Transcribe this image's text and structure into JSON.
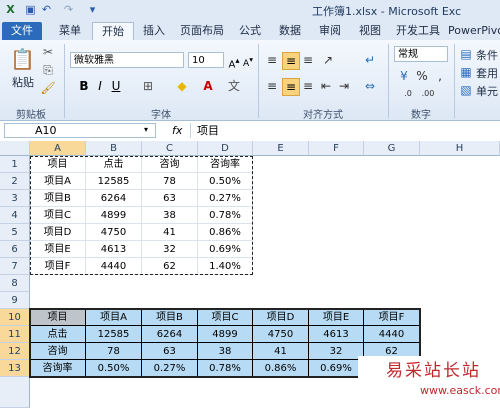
{
  "window": {
    "title": "工作簿1.xlsx - Microsoft Exc"
  },
  "tabs": [
    "文件",
    "菜单",
    "开始",
    "插入",
    "页面布局",
    "公式",
    "数据",
    "审阅",
    "视图",
    "开发工具",
    "PowerPivo"
  ],
  "ribbon": {
    "paste_label": "粘贴",
    "font_name": "微软雅黑",
    "font_size": "10",
    "bold": "B",
    "italic": "I",
    "underline": "U",
    "number_format": "常规",
    "styles_cond": "条件",
    "styles_table": "套用",
    "styles_cell": "单元",
    "groups": [
      "剪贴板",
      "字体",
      "对齐方式",
      "数字"
    ]
  },
  "formula_bar": {
    "name_box": "A10",
    "fx": "fx",
    "content": "项目"
  },
  "columns": [
    "A",
    "B",
    "C",
    "D",
    "E",
    "F",
    "G",
    "H"
  ],
  "rows": [
    "1",
    "2",
    "3",
    "4",
    "5",
    "6",
    "7",
    "8",
    "9",
    "10",
    "11",
    "12",
    "13"
  ],
  "table1": {
    "header": [
      "项目",
      "点击",
      "咨询",
      "咨询率"
    ],
    "rows": [
      [
        "项目A",
        "12585",
        "78",
        "0.50%"
      ],
      [
        "项目B",
        "6264",
        "63",
        "0.27%"
      ],
      [
        "项目C",
        "4899",
        "38",
        "0.78%"
      ],
      [
        "项目D",
        "4750",
        "41",
        "0.86%"
      ],
      [
        "项目E",
        "4613",
        "32",
        "0.69%"
      ],
      [
        "项目F",
        "4440",
        "62",
        "1.40%"
      ]
    ]
  },
  "table2": {
    "rows": [
      [
        "项目",
        "项目A",
        "项目B",
        "项目C",
        "项目D",
        "项目E",
        "项目F"
      ],
      [
        "点击",
        "12585",
        "6264",
        "4899",
        "4750",
        "4613",
        "4440"
      ],
      [
        "咨询",
        "78",
        "63",
        "38",
        "41",
        "32",
        "62"
      ],
      [
        "咨询率",
        "0.50%",
        "0.27%",
        "0.78%",
        "0.86%",
        "0.69%",
        "1."
      ]
    ]
  },
  "watermark": {
    "line1": "易采站长站",
    "line2": "www.easck.com"
  }
}
